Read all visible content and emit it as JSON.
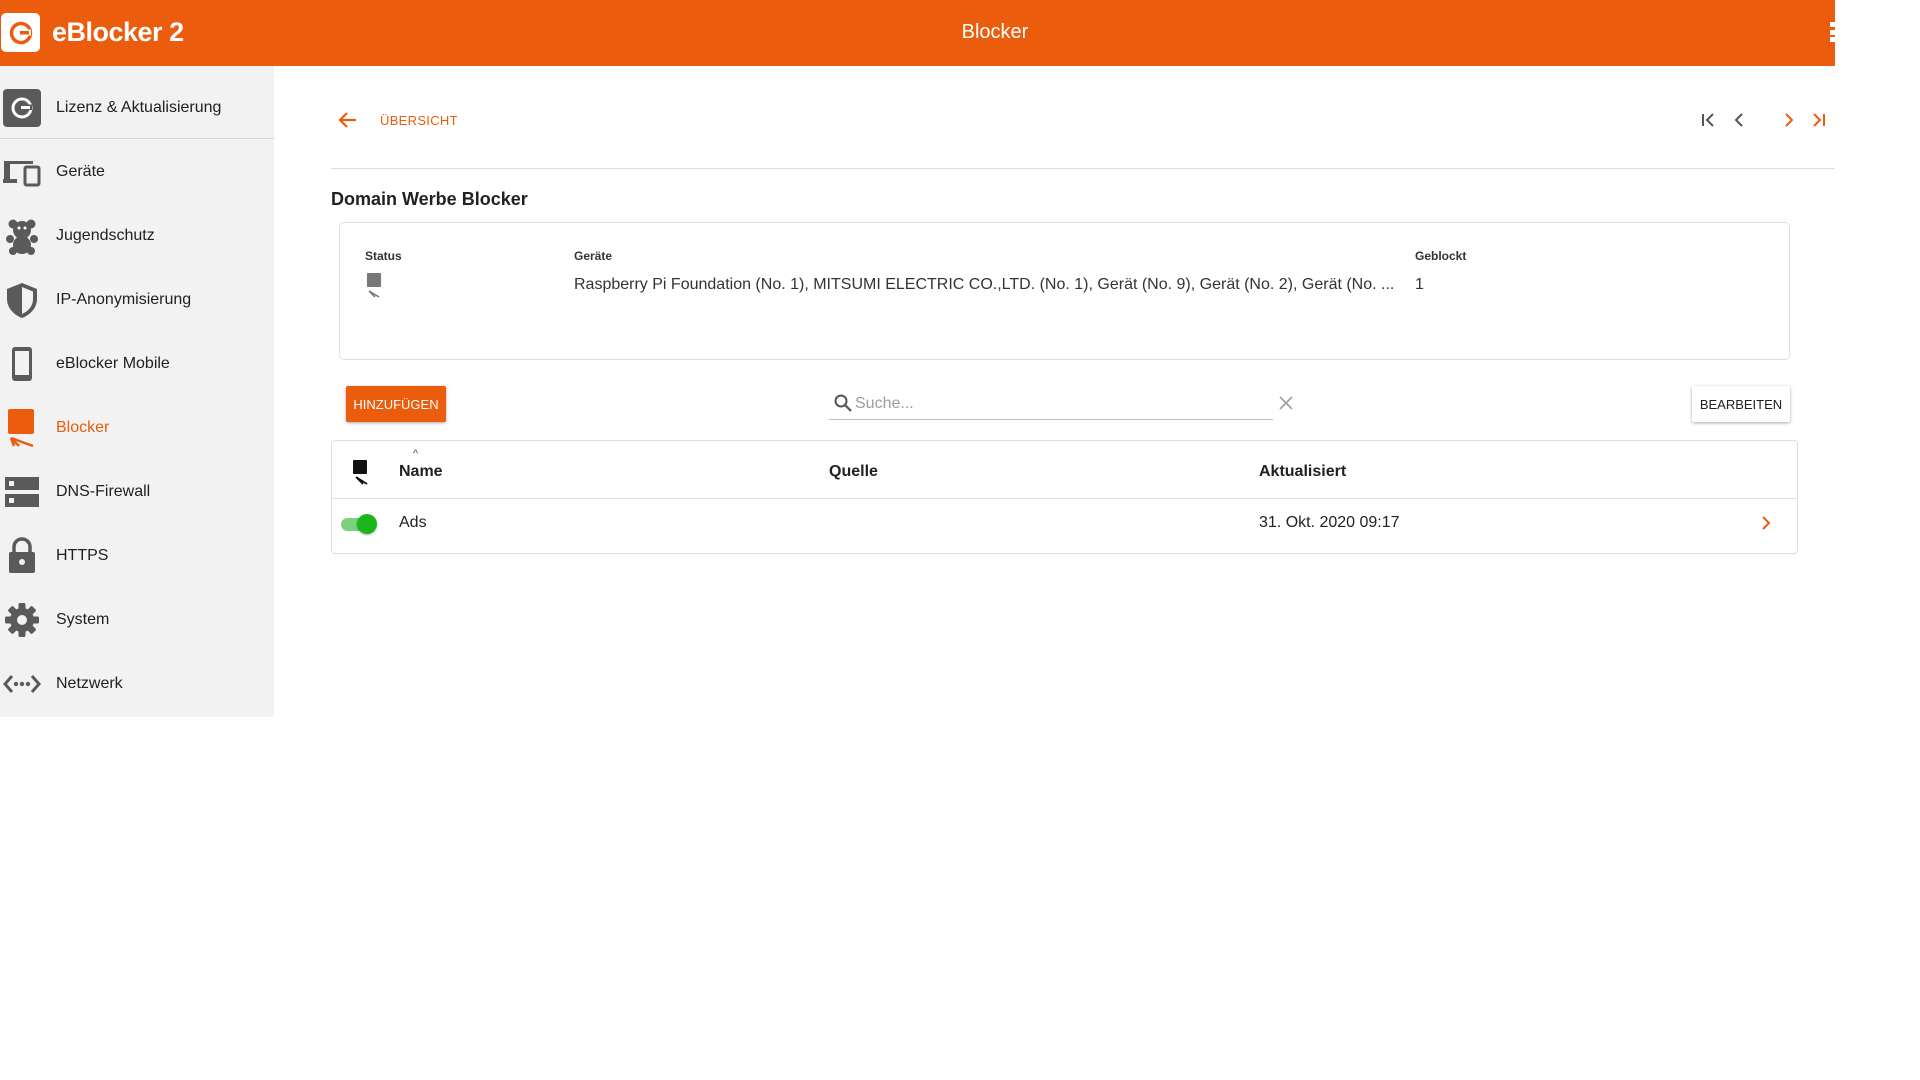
{
  "header": {
    "brand": "eBlocker 2",
    "title": "Blocker",
    "accent_color": "#eb5c0c",
    "logo_icon": "eblocker-logo-icon",
    "menu_icon": "more-vert-icon"
  },
  "sidebar": {
    "items": [
      {
        "label": "Lizenz & Aktualisierung",
        "icon": "refresh-icon",
        "active": false
      },
      {
        "label": "Geräte",
        "icon": "devices-icon",
        "active": false
      },
      {
        "label": "Jugendschutz",
        "icon": "teddy-bear-icon",
        "active": false
      },
      {
        "label": "IP-Anonymisierung",
        "icon": "shield-icon",
        "active": false
      },
      {
        "label": "eBlocker Mobile",
        "icon": "phone-icon",
        "active": false
      },
      {
        "label": "Blocker",
        "icon": "blocker-icon",
        "active": true
      },
      {
        "label": "DNS-Firewall",
        "icon": "server-icon",
        "active": false
      },
      {
        "label": "HTTPS",
        "icon": "lock-icon",
        "active": false
      },
      {
        "label": "System",
        "icon": "gear-icon",
        "active": false
      },
      {
        "label": "Netzwerk",
        "icon": "network-icon",
        "active": false
      }
    ]
  },
  "nav": {
    "back_label": "ÜBERSICHT",
    "pager_icons": [
      "first-page-icon",
      "prev-page-icon",
      "next-page-icon",
      "last-page-icon"
    ]
  },
  "section": {
    "title": "Domain Werbe Blocker"
  },
  "info": {
    "status_label": "Status",
    "status_icon": "blocker-status-icon",
    "devices_label": "Geräte",
    "devices_value": "Raspberry Pi Foundation (No. 1), MITSUMI ELECTRIC CO.,LTD. (No. 1), Gerät (No. 9), Gerät (No. 2), Gerät (No. ...",
    "blocked_label": "Geblockt",
    "blocked_value": "1"
  },
  "toolbar": {
    "add_label": "HINZUFÜGEN",
    "search_placeholder": "Suche...",
    "search_value": "",
    "edit_label": "BEARBEITEN"
  },
  "table": {
    "columns": [
      "Name",
      "Quelle",
      "Aktualisiert"
    ],
    "sort_indicator": "^",
    "rows": [
      {
        "enabled": true,
        "name": "Ads",
        "source": "",
        "updated": "31. Okt. 2020 09:17"
      }
    ]
  }
}
